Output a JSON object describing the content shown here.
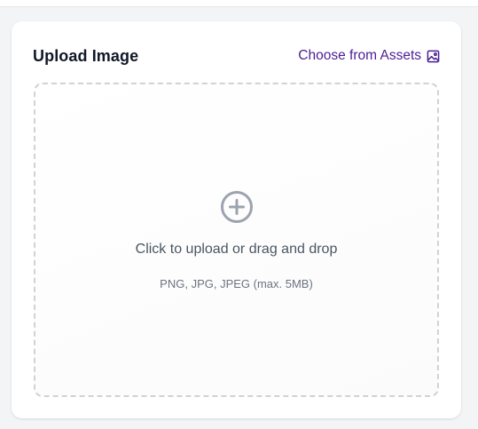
{
  "card": {
    "title": "Upload Image",
    "choose_link_label": "Choose from Assets",
    "choose_link_icon": "image-icon"
  },
  "dropzone": {
    "icon": "plus-circle-icon",
    "primary_text": "Click to upload or drag and drop",
    "secondary_text": "PNG, JPG, JPEG (max. 5MB)"
  },
  "colors": {
    "link": "#4c1d95",
    "icon_gray": "#9ca3af",
    "dashed_border": "#cfd2d6"
  }
}
